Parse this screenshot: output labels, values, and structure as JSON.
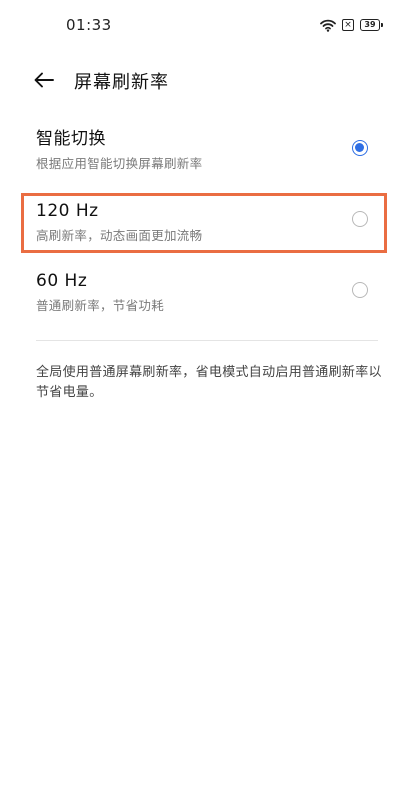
{
  "status_bar": {
    "time": "01:33",
    "sim_label": "×",
    "battery_level": "39"
  },
  "header": {
    "title": "屏幕刷新率"
  },
  "options": [
    {
      "title": "智能切换",
      "subtitle": "根据应用智能切换屏幕刷新率",
      "selected": true
    },
    {
      "title": "120 Hz",
      "subtitle": "高刷新率，动态画面更加流畅",
      "selected": false
    },
    {
      "title": "60 Hz",
      "subtitle": "普通刷新率，节省功耗",
      "selected": false
    }
  ],
  "footnote": "全局使用普通屏幕刷新率，省电模式自动启用普通刷新率以节省电量。",
  "colors": {
    "accent": "#2f6fe4",
    "highlight": "#ea6d42"
  },
  "icons": {
    "back": "arrow-left-icon",
    "wifi": "wifi-icon",
    "sim": "sim-card-icon",
    "battery": "battery-icon"
  }
}
